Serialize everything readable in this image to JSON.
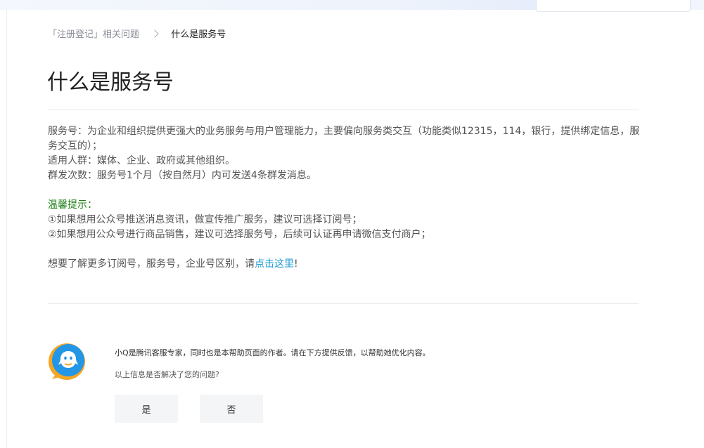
{
  "breadcrumb": {
    "parent": "「注册登记」相关问题",
    "current": "什么是服务号"
  },
  "article": {
    "title": "什么是服务号",
    "para1": "服务号：为企业和组织提供更强大的业务服务与用户管理能力，主要偏向服务类交互（功能类似12315，114，银行，提供绑定信息，服务交互的）；",
    "para2": "适用人群：媒体、企业、政府或其他组织。",
    "para3": "群发次数：服务号1个月（按自然月）内可发送4条群发消息。",
    "tip_title": "温馨提示：",
    "tip1": "①如果想用公众号推送消息资讯，做宣传推广服务，建议可选择订阅号；",
    "tip2": "②如果想用公众号进行商品销售，建议可选择服务号，后续可认证再申请微信支付商户；",
    "more_prefix": "想要了解更多订阅号，服务号，企业号区别，请",
    "more_link": "点击这里",
    "more_suffix": "!"
  },
  "feedback": {
    "author_note": "小Q是腾讯客服专家，同时也是本帮助页面的作者。请在下方提供反馈，以帮助她优化内容。",
    "question": "以上信息是否解决了您的问题?",
    "yes_label": "是",
    "no_label": "否"
  },
  "colors": {
    "tip_green": "#1a7e12",
    "link_blue": "#1f9cd6",
    "avatar_orange": "#f5a623",
    "avatar_blue": "#2496e6"
  }
}
